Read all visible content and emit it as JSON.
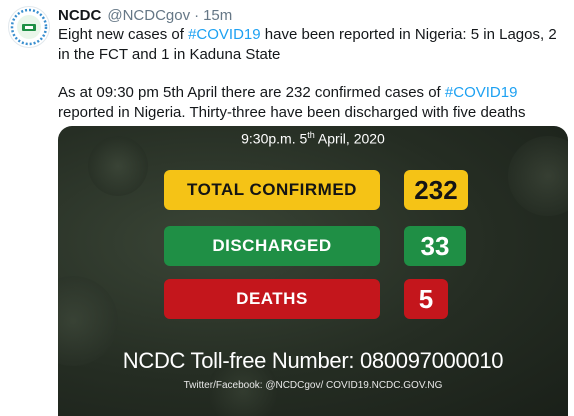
{
  "tweet": {
    "name": "NCDC",
    "handle": "@NCDCgov",
    "separator": "·",
    "time": "15m",
    "line1_before": "Eight new cases of ",
    "hashtag1": "#COVID19",
    "line1_after": " have been reported in Nigeria: 5 in Lagos, 2 in the FCT and 1 in Kaduna State",
    "line2_before": "As at 09:30 pm 5th April there are 232 confirmed cases of ",
    "hashtag2": "#COVID19",
    "line2_after": " reported in Nigeria. Thirty-three have been discharged with five deaths"
  },
  "card": {
    "date_prefix": "9:30p.m. 5",
    "date_sup": "th",
    "date_suffix": " April, 2020",
    "total_label": "TOTAL CONFIRMED",
    "total_value": "232",
    "discharged_label": "DISCHARGED",
    "discharged_value": "33",
    "deaths_label": "DEATHS",
    "deaths_value": "5",
    "tollfree": "NCDC Toll-free Number: 080097000010",
    "social": "Twitter/Facebook: @NCDCgov/ COVID19.NCDC.GOV.NG"
  },
  "colors": {
    "hashtag": "#1da1f2",
    "confirmed": "#f5c316",
    "discharged": "#1f8f45",
    "deaths": "#c4161c"
  },
  "icons": {
    "avatar": "ncdc-logo-icon"
  }
}
